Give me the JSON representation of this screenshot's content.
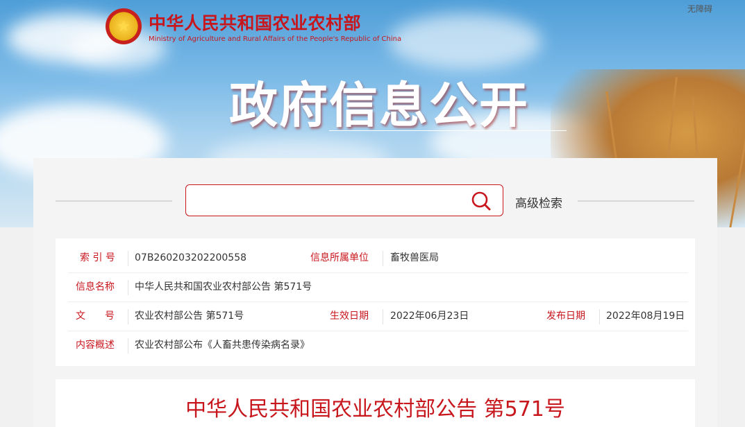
{
  "header": {
    "ministry_name": "中华人民共和国农业农村部",
    "ministry_name_en": "Ministry of Agriculture and Rural Affairs of the People's Republic of China",
    "accessibility_link": "无障碍",
    "section_title": "政府信息公开",
    "emblem_icon": "national-emblem-icon"
  },
  "search": {
    "placeholder": "",
    "value": "",
    "advanced_label": "高级检索",
    "icon": "search-icon",
    "accent_color": "#c8161d"
  },
  "info": {
    "index_label": "索 引 号",
    "index_value": "07B260203202200558",
    "unit_label": "信息所属单位",
    "unit_value": "畜牧兽医局",
    "name_label": "信息名称",
    "name_value": "中华人民共和国农业农村部公告 第571号",
    "doc_no_label": "文　　号",
    "doc_no_value": "农业农村部公告 第571号",
    "effective_label": "生效日期",
    "effective_value": "2022年06月23日",
    "publish_label": "发布日期",
    "publish_value": "2022年08月19日",
    "summary_label": "内容概述",
    "summary_value": "农业农村部公布《人畜共患传染病名录》"
  },
  "document": {
    "title": "中华人民共和国农业农村部公告 第571号"
  }
}
